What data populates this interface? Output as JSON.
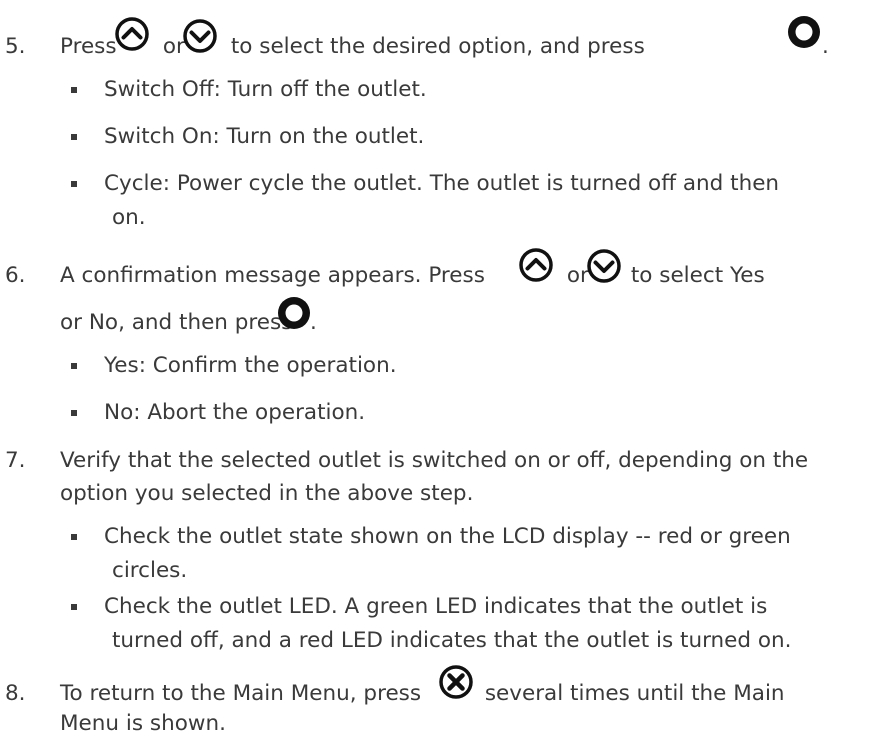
{
  "steps": [
    {
      "number": "5.",
      "text_parts": [
        "Press ",
        " or ",
        " to select the desired option, and press ",
        "."
      ],
      "options": [
        "Switch Off: Turn off the outlet.",
        "Switch On: Turn on the outlet.",
        "Cycle: Power cycle the outlet. The outlet is turned off and then",
        "on."
      ]
    },
    {
      "number": "6.",
      "text_parts": [
        "A confirmation message appears. Press ",
        " or ",
        " to select Yes",
        "or No, and then press ",
        "."
      ],
      "options": [
        "Yes: Confirm the operation.",
        "No: Abort the operation."
      ]
    },
    {
      "number": "7.",
      "lines": [
        "Verify that the selected outlet is switched on or off, depending on the",
        "option you selected in the above step."
      ],
      "options": [
        "Check the outlet state shown on the LCD display -- red or green",
        "circles.",
        "Check the outlet LED. A green LED indicates that the outlet is",
        "turned off, and a red LED indicates that the outlet is turned on."
      ]
    },
    {
      "number": "8.",
      "text_parts": [
        "To return to the Main Menu, press ",
        " several times until the Main",
        "Menu is shown."
      ]
    }
  ],
  "icons": {
    "up": "up-arrow-button-icon",
    "down": "down-arrow-button-icon",
    "ok": "ok-button-icon",
    "close": "close-button-icon"
  }
}
